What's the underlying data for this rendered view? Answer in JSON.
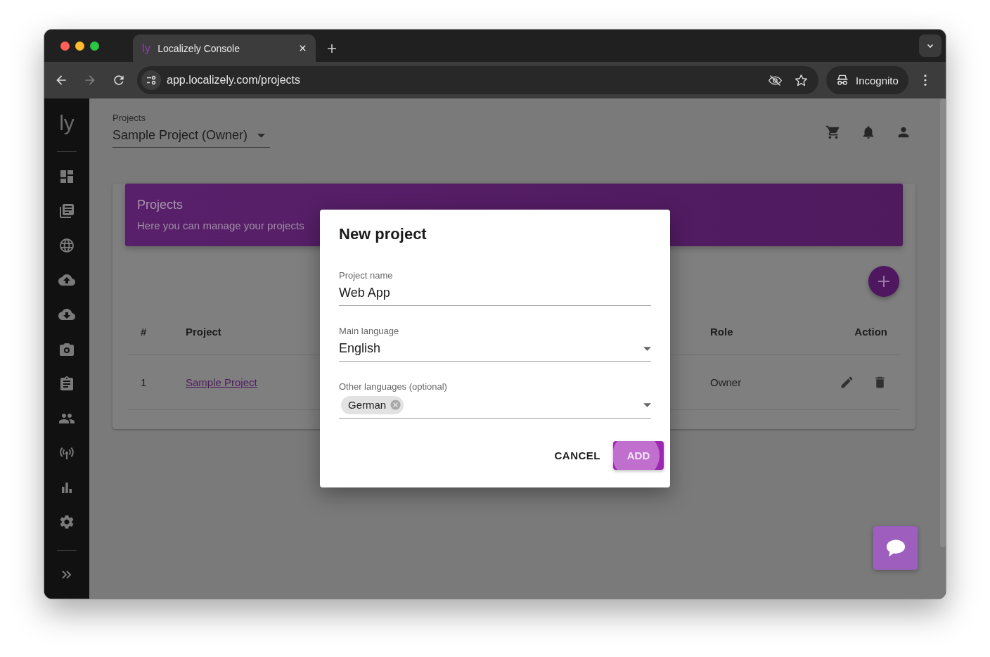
{
  "browser": {
    "tab": {
      "favicon": "ly",
      "title": "Localizely Console"
    },
    "url": "app.localizely.com/projects",
    "profile": "Incognito"
  },
  "sidebar": {
    "logo": "ly"
  },
  "header": {
    "label": "Projects",
    "project": "Sample Project (Owner)"
  },
  "banner": {
    "title": "Projects",
    "subtitle": "Here you can manage your projects"
  },
  "table": {
    "columns": [
      {
        "kind": "number",
        "label": "#"
      },
      {
        "kind": "project",
        "label": "Project"
      },
      {
        "kind": "role",
        "label": "Role"
      },
      {
        "kind": "action",
        "label": "Action"
      }
    ],
    "rows": [
      {
        "number": "1",
        "project": "Sample Project",
        "role": "Owner"
      }
    ]
  },
  "dialog": {
    "title": "New project",
    "fields": [
      {
        "kind": "text",
        "label": "Project name",
        "value": "Web App"
      },
      {
        "kind": "select",
        "label": "Main language",
        "value": "English"
      },
      {
        "kind": "chips",
        "label": "Other languages (optional)",
        "chips": [
          "German"
        ]
      }
    ],
    "buttons": [
      {
        "kind": "text",
        "label": "CANCEL"
      },
      {
        "kind": "contained",
        "label": "ADD"
      }
    ]
  }
}
